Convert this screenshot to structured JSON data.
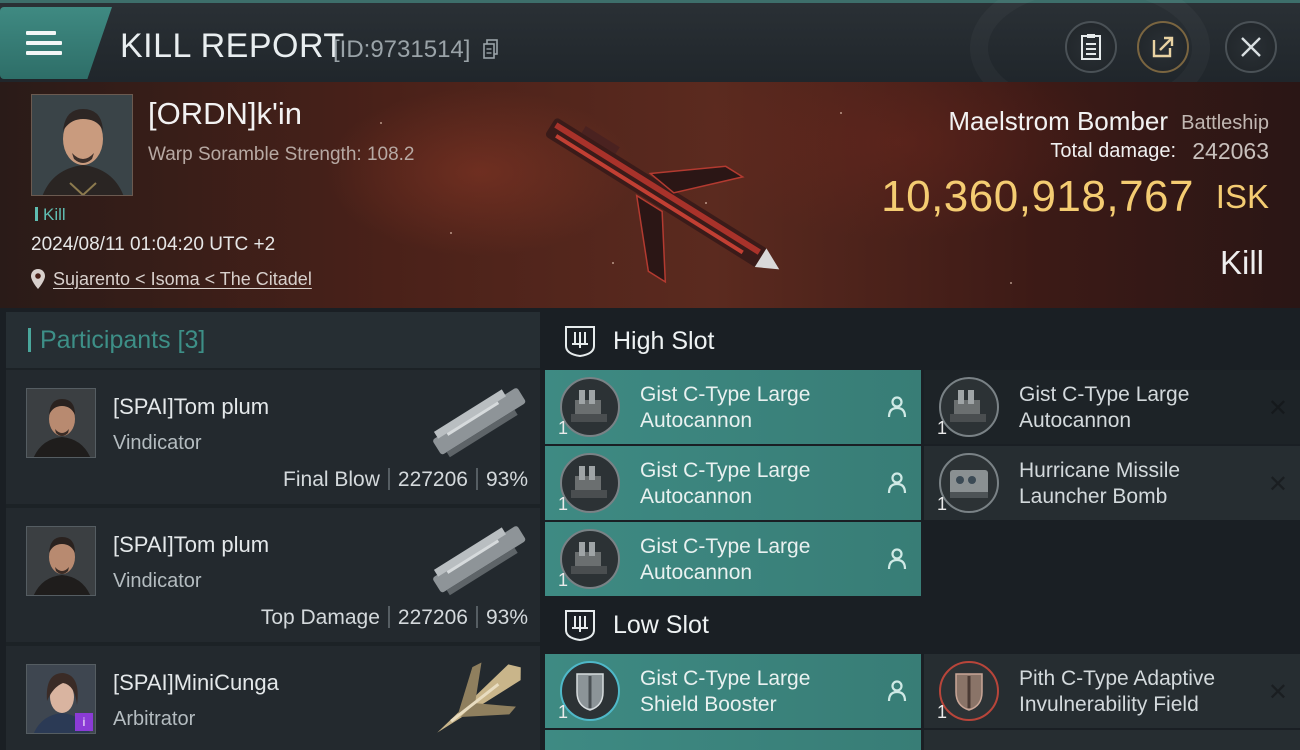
{
  "header": {
    "title": "KILL REPORT",
    "kill_id": "[ID:9731514]"
  },
  "victim": {
    "name": "[ORDN]k'in",
    "scramble": "Warp Soramble Strength: 108.2",
    "tag": "Kill",
    "datetime": "2024/08/11 01:04:20 UTC +2",
    "location": "Sujarento < Isoma < The Citadel",
    "ship_name": "Maelstrom Bomber",
    "ship_class": "Battleship",
    "damage_label": "Total damage:",
    "damage_value": "242063",
    "isk_value": "10,360,918,767",
    "isk_unit": "ISK",
    "result": "Kill"
  },
  "participants": {
    "title": "Participants [3]",
    "rows": [
      {
        "name": "[SPAI]Tom plum",
        "ship": "Vindicator",
        "role": "Final Blow",
        "damage": "227206",
        "percent": "93%"
      },
      {
        "name": "[SPAI]Tom plum",
        "ship": "Vindicator",
        "role": "Top Damage",
        "damage": "227206",
        "percent": "93%"
      },
      {
        "name": "[SPAI]MiniCunga",
        "ship": "Arbitrator",
        "badge": "i"
      }
    ]
  },
  "high_slot": {
    "title": "High Slot",
    "modules": [
      {
        "name": "Gist C-Type Large Autocannon",
        "qty": "1"
      },
      {
        "name": "Gist C-Type Large Autocannon",
        "qty": "1"
      },
      {
        "name": "Gist C-Type Large Autocannon",
        "qty": "1"
      },
      {
        "name": "Hurricane Missile Launcher Bomb",
        "qty": "1"
      },
      {
        "name": "Gist C-Type Large Autocannon",
        "qty": "1"
      }
    ]
  },
  "low_slot": {
    "title": "Low Slot",
    "modules": [
      {
        "name": "Gist C-Type Large Shield Booster",
        "qty": "1"
      },
      {
        "name": "Pith C-Type Adaptive Invulnerability Field",
        "qty": "1"
      }
    ]
  },
  "colors": {
    "accent_teal": "#3e8a83",
    "isk_gold": "#f4cc72",
    "kill_teal": "#5fbdb1"
  }
}
